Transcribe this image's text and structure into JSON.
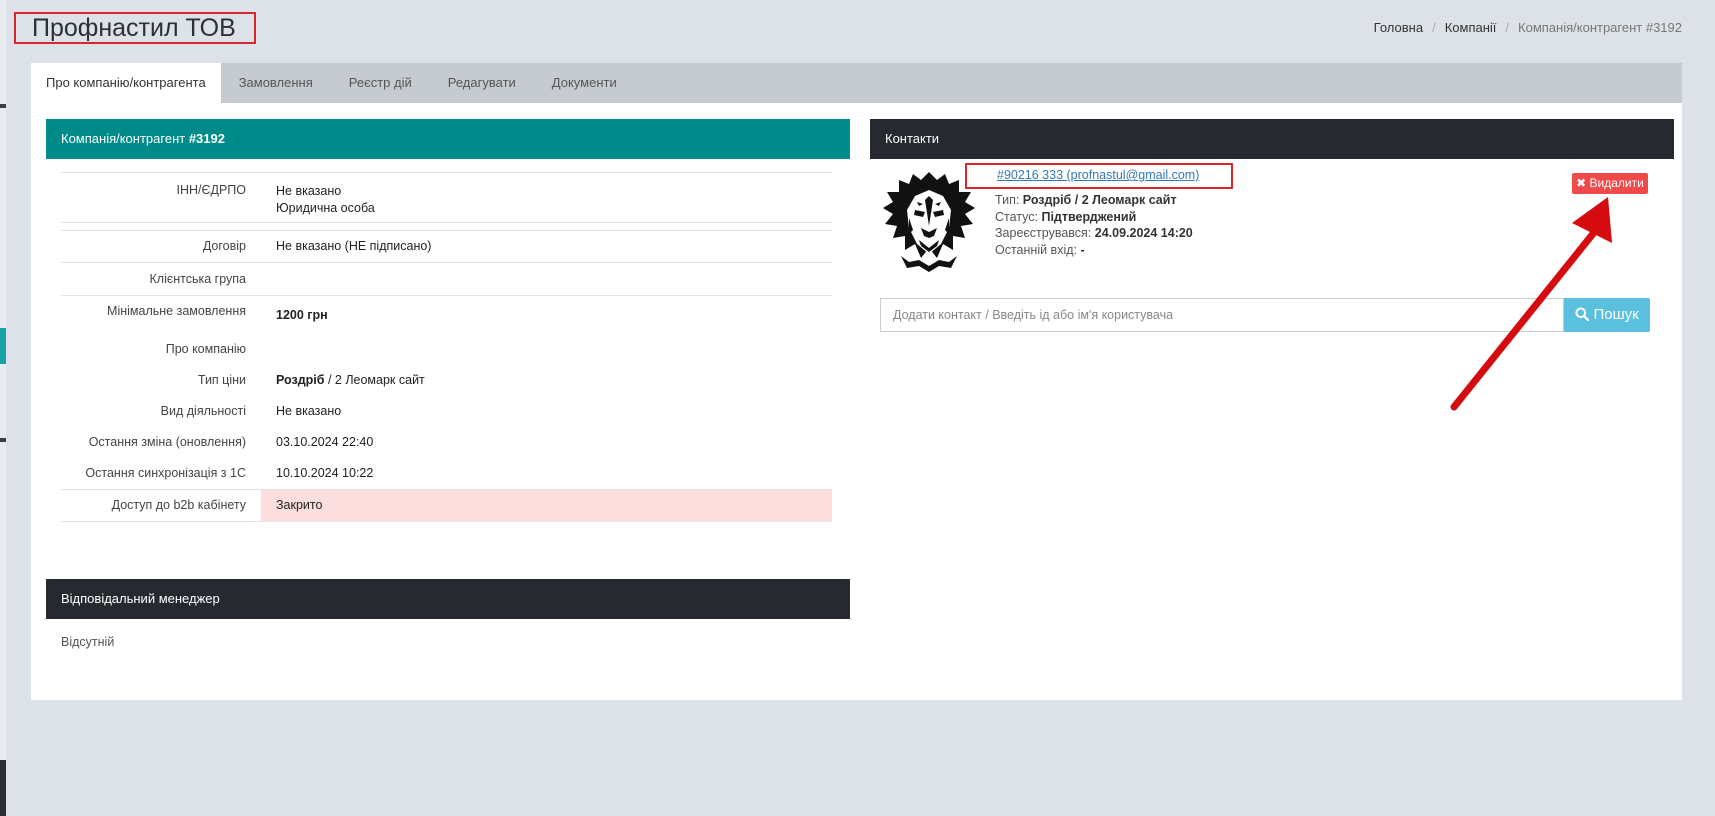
{
  "page": {
    "title": "Профнастил ТОВ"
  },
  "breadcrumb": [
    "Головна",
    "Компанії",
    "Компанія/контрагент #3192"
  ],
  "tabs": [
    {
      "label": "Про компанію/контрагента",
      "active": true
    },
    {
      "label": "Замовлення"
    },
    {
      "label": "Реєстр дій"
    },
    {
      "label": "Редагувати"
    },
    {
      "label": "Документи"
    }
  ],
  "company_box": {
    "header_prefix": "Компанія/контрагент ",
    "header_id": "#3192",
    "rows": [
      {
        "label": "ІНН/ЄДРПО",
        "value": "Не вказано",
        "value2": "Юридична особа"
      },
      {
        "label": "",
        "value": ""
      },
      {
        "label": "Договір",
        "value": "Не вказано (НЕ підписано)"
      },
      {
        "label": "Клієнтська група",
        "value": ""
      },
      {
        "label": "Мінімальне замовлення",
        "value": "1200 грн"
      },
      {
        "label": "Про компанію",
        "value": ""
      },
      {
        "label": "Тип ціни",
        "value_bold": "Роздріб",
        "value": " / 2 Леомарк сайт"
      },
      {
        "label": "Вид діяльності",
        "value": "Не вказано"
      },
      {
        "label": "Остання зміна (оновлення)",
        "value": "03.10.2024 22:40"
      },
      {
        "label": "Остання синхронізація з 1С",
        "value": "10.10.2024 10:22"
      },
      {
        "label": "Доступ до b2b кабінету",
        "value": "Закрито"
      }
    ]
  },
  "manager_box": {
    "header": "Відповідальний менеджер",
    "empty_text": "Відсутній"
  },
  "contacts_box": {
    "header": "Контакти",
    "contact": {
      "link": "#90216 333 (profnastul@gmail.com)",
      "type_label": "Тип: ",
      "type_value": "Роздріб / 2 Леомарк сайт",
      "status_label": "Статус: ",
      "status_value": "Підтверджений",
      "registered_label": "Зареєструвався: ",
      "registered_value": "24.09.2024 14:20",
      "last_login_label": "Останній вхід: ",
      "last_login_value": "-"
    },
    "delete_label": "Видалити",
    "search_placeholder": "Додати контакт / Введіть ід або ім'я користувача",
    "search_button": "Пошук"
  },
  "colors": {
    "teal_header": "#008b8b",
    "dark_header": "#262a30",
    "danger": "#f0494a",
    "info": "#5bc0de",
    "highlight_border": "#d9262c"
  }
}
